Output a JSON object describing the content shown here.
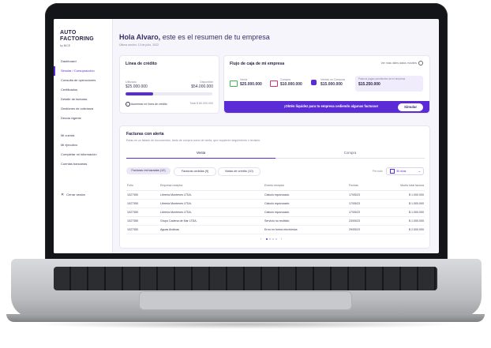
{
  "logo": {
    "line1": "AUTO",
    "line2": "FACTORING",
    "by": "by BICE"
  },
  "sidebar": {
    "items": [
      {
        "label": "Dashboard",
        "active": false
      },
      {
        "label": "Simular / Cursopracción",
        "active": true
      },
      {
        "label": "Consulta de operaciones",
        "active": false
      },
      {
        "label": "Certificados",
        "active": false
      },
      {
        "label": "Detalle de facturas",
        "active": false
      },
      {
        "label": "Gestiones de cobranza",
        "active": false
      },
      {
        "label": "Deuda vigente",
        "active": false
      }
    ],
    "items2": [
      {
        "label": "Mi cuenta"
      },
      {
        "label": "Mi ejecutivo"
      },
      {
        "label": "Completar mi información"
      },
      {
        "label": "Cuentas bancarias"
      }
    ],
    "logout": "Cerrar sesión"
  },
  "header": {
    "greeting_name": "Hola Alvaro,",
    "greeting_rest": " este es el resumen de tu empresa",
    "date": "Última sesión: 13 de julio, 2022"
  },
  "credit": {
    "title": "Línea de crédito",
    "used_label": "Utilizado",
    "used_value": "$25.000.000",
    "available_label": "Disponible",
    "available_value": "$54.000.000",
    "used_fraction": 0.32,
    "increase_text": "Aumentar mi línea de crédito",
    "total_text": "Total $ 80.000.000"
  },
  "cashflow": {
    "title": "Flujo de caja de mi empresa",
    "help_text": "Ver más útiles datos móviles",
    "venta_label": "Venta",
    "venta_value": "$25.000.000",
    "compra_label": "Compra",
    "compra_value": "$10.000.000",
    "ventas_compras_label": "Ventas vs Compras",
    "ventas_compras_value": "$15.000.000",
    "pending_label": "Pasivos pagos pendientes de mi empresa",
    "pending_value": "$15.250.000",
    "banner": "¡Obtén liquidez para tu empresa cediendo algunas facturas!",
    "simular": "Simular"
  },
  "alerts": {
    "title": "Facturas con alerta",
    "subtitle": "Estas es un listado de documentos, tanto de compra como de venta, que requieren seguimiento o revisión.",
    "tabs": [
      "Venta",
      "Compra"
    ],
    "pills": [
      "Facturas rechazadas (12)",
      "Facturas cedidas (9)",
      "Notas de crédito (10)"
    ],
    "period_label": "Período",
    "period_value": "30 días",
    "columns": [
      "Folio",
      "Empresa receptor",
      "Evento receptor",
      "Fechas",
      "Monto total factura"
    ],
    "rows": [
      [
        "1027350",
        "Librería Montenes LTDA.",
        "Cálculo equivocado",
        "17/05/23",
        "$ 1.000.000"
      ],
      [
        "1027350",
        "Librería Montenes LTDA.",
        "Cálculo equivocado",
        "17/05/23",
        "$ 1.000.000"
      ],
      [
        "1027350",
        "Librería Montenes LTDA.",
        "Cálculo equivocado",
        "17/05/23",
        "$ 1.000.000"
      ],
      [
        "1027350",
        "Grupo Cadena de Mar LTDA.",
        "Servicio no recibido",
        "23/05/23",
        "$ 1.000.000"
      ],
      [
        "1027350",
        "Aguas Andinas",
        "Error en forma electrónica",
        "29/05/23",
        "$ 2.000.000"
      ]
    ]
  },
  "colors": {
    "accent": "#5b2bd6",
    "venta": "#3fb950",
    "compra": "#d6336c",
    "vc": "#5b2bd6"
  }
}
